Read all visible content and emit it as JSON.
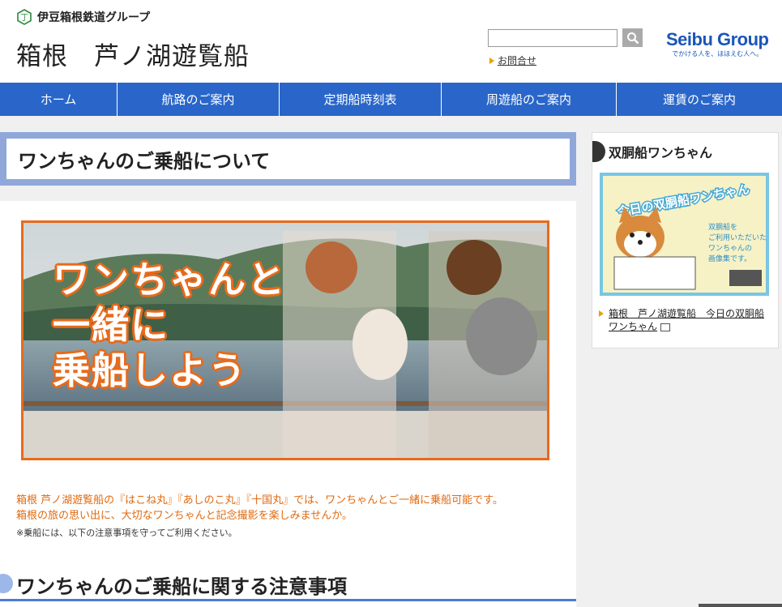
{
  "header": {
    "group_name": "伊豆箱根鉄道グループ",
    "site_title": "箱根　芦ノ湖遊覧船",
    "inquiry_label": "お問合せ",
    "seibu_name": "Seibu Group",
    "seibu_tagline": "でかける人を、ほほえむ人へ。"
  },
  "nav": {
    "items": [
      {
        "label": "ホーム"
      },
      {
        "label": "航路のご案内"
      },
      {
        "label": "定期船時刻表"
      },
      {
        "label": "周遊船のご案内"
      },
      {
        "label": "運賃のご案内"
      }
    ]
  },
  "main": {
    "page_title": "ワンちゃんのご乗船について",
    "hero_text": [
      "ワンちゃんと",
      "一緒に",
      "乗船しよう"
    ],
    "intro_lines": [
      "箱根 芦ノ湖遊覧船の『はこね丸』『あしのこ丸』『十国丸』では、ワンちゃんとご一緒に乗船可能です。",
      "箱根の旅の思い出に、大切なワンちゃんと記念撮影を楽しみませんか。"
    ],
    "note": "※乗船には、以下の注意事項を守ってご利用ください。",
    "section_title": "ワンちゃんのご乗船に関する注意事項"
  },
  "sidebar": {
    "heading": "双胴船ワンちゃん",
    "banner_title": "今日の双胴船ワンちゃん",
    "banner_text": [
      "双胴船を",
      "ご利用いただいた",
      "ワンちゃんの",
      "画像集です。"
    ],
    "link_text": "箱根　芦ノ湖遊覧船　今日の双胴船ワンちゃん"
  },
  "colors": {
    "nav_bg": "#2a66c9",
    "accent_orange": "#e86a1a",
    "title_frame": "#8fa8d9",
    "seibu_blue": "#1a56b8"
  }
}
